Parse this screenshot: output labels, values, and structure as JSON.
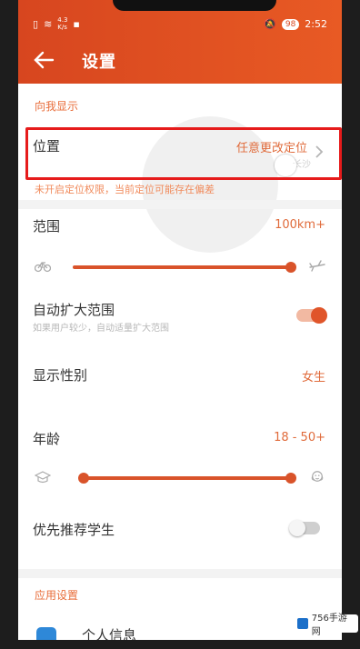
{
  "status_bar": {
    "network_speed": "4.3\nK/s",
    "battery": "98",
    "time": "2:52"
  },
  "header": {
    "title": "设置"
  },
  "section_display": {
    "label": "向我显示"
  },
  "location": {
    "title": "位置",
    "value": "任意更改定位",
    "note": "长沙",
    "warning": "未开启定位权限，当前定位可能存在偏差"
  },
  "range": {
    "title": "范围",
    "value": "100km+",
    "level": 1.0
  },
  "auto_expand": {
    "title": "自动扩大范围",
    "subtitle": "如果用户较少，自动适量扩大范围",
    "enabled": true
  },
  "gender": {
    "title": "显示性别",
    "value": "女生"
  },
  "age": {
    "title": "年龄",
    "value": "18 - 50+",
    "min": 18,
    "max": "50+"
  },
  "students": {
    "title": "优先推荐学生",
    "enabled": false
  },
  "section_app": {
    "label": "应用设置"
  },
  "personal_info": {
    "title": "个人信息"
  },
  "watermark": {
    "text": "756手游网"
  },
  "colors": {
    "accent": "#d9532a",
    "header": "#e05a25",
    "highlight": "#e61b1b"
  }
}
